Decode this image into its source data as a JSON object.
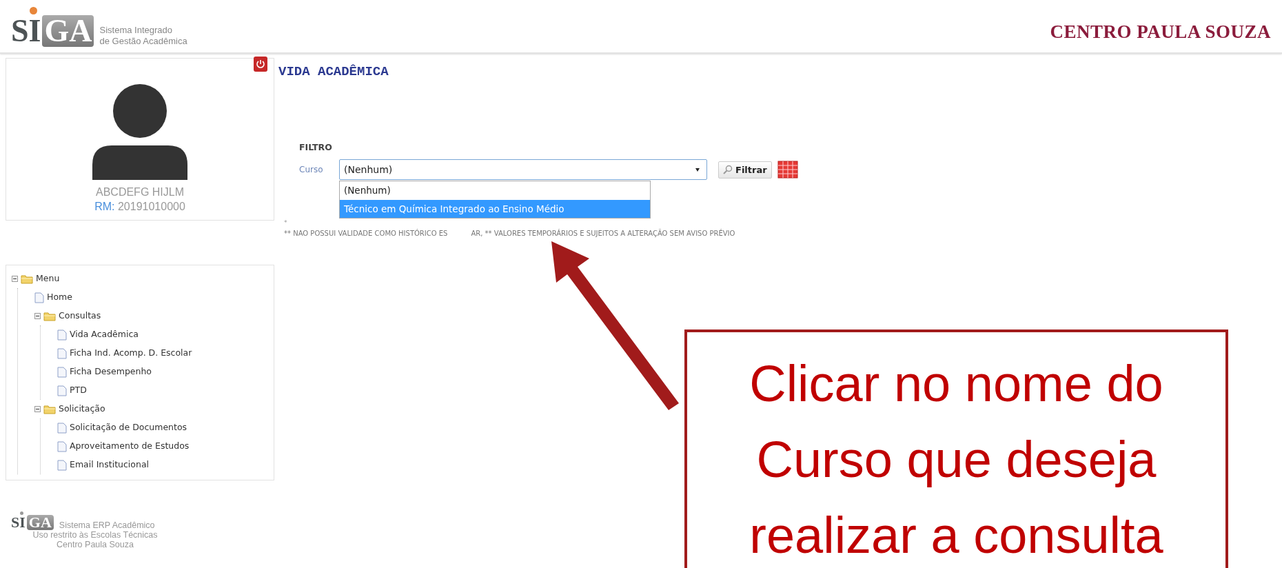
{
  "header": {
    "logo": {
      "mark_left": "SI",
      "mark_right": "GA",
      "line_1": "Sistema Integrado",
      "line_2": "de Gestão Acadêmica"
    },
    "brand": "CENTRO PAULA SOUZA"
  },
  "profile": {
    "name": "ABCDEFG HIJLM",
    "rm_label": "RM:",
    "rm_value": "20191010000"
  },
  "page_title": "VIDA ACADÊMICA",
  "filter": {
    "heading": "FILTRO",
    "label": "Curso",
    "value": "(Nenhum)",
    "expanded": true,
    "options": [
      {
        "label": "(Nenhum)",
        "highlighted": false
      },
      {
        "label": "Técnico em Química Integrado ao Ensino Médio",
        "highlighted": true
      }
    ],
    "button": "Filtrar"
  },
  "note_mark": "*",
  "notice": [
    "** NAO POSSUI VALIDADE COMO HISTÓRICO ES",
    "AR, ** VALORES TEMPORÁRIOS E SUJEITOS A ALTERAÇÃO SEM AVISO PRÉVIO"
  ],
  "menu": {
    "label": "Menu",
    "kind": "folder",
    "expanded": true,
    "children": [
      {
        "label": "Home",
        "kind": "page"
      },
      {
        "label": "Consultas",
        "kind": "folder",
        "expanded": true,
        "children": [
          {
            "label": "Vida Acadêmica",
            "kind": "page"
          },
          {
            "label": "Ficha Ind. Acomp. D. Escolar",
            "kind": "page"
          },
          {
            "label": "Ficha Desempenho",
            "kind": "page"
          },
          {
            "label": "PTD",
            "kind": "page"
          }
        ]
      },
      {
        "label": "Solicitação",
        "kind": "folder",
        "expanded": true,
        "children": [
          {
            "label": "Solicitação de Documentos",
            "kind": "page"
          },
          {
            "label": "Aproveitamento de Estudos",
            "kind": "page"
          },
          {
            "label": "Email Institucional",
            "kind": "page"
          }
        ]
      }
    ]
  },
  "footer": {
    "mark_left": "SI",
    "mark_right": "GA",
    "line_1": "Sistema ERP Acadêmico",
    "line_2": "Uso restrito às Escolas Técnicas",
    "line_3": "Centro Paula Souza"
  },
  "callout": {
    "text": "Clicar no nome do Curso que deseja realizar a consulta"
  }
}
